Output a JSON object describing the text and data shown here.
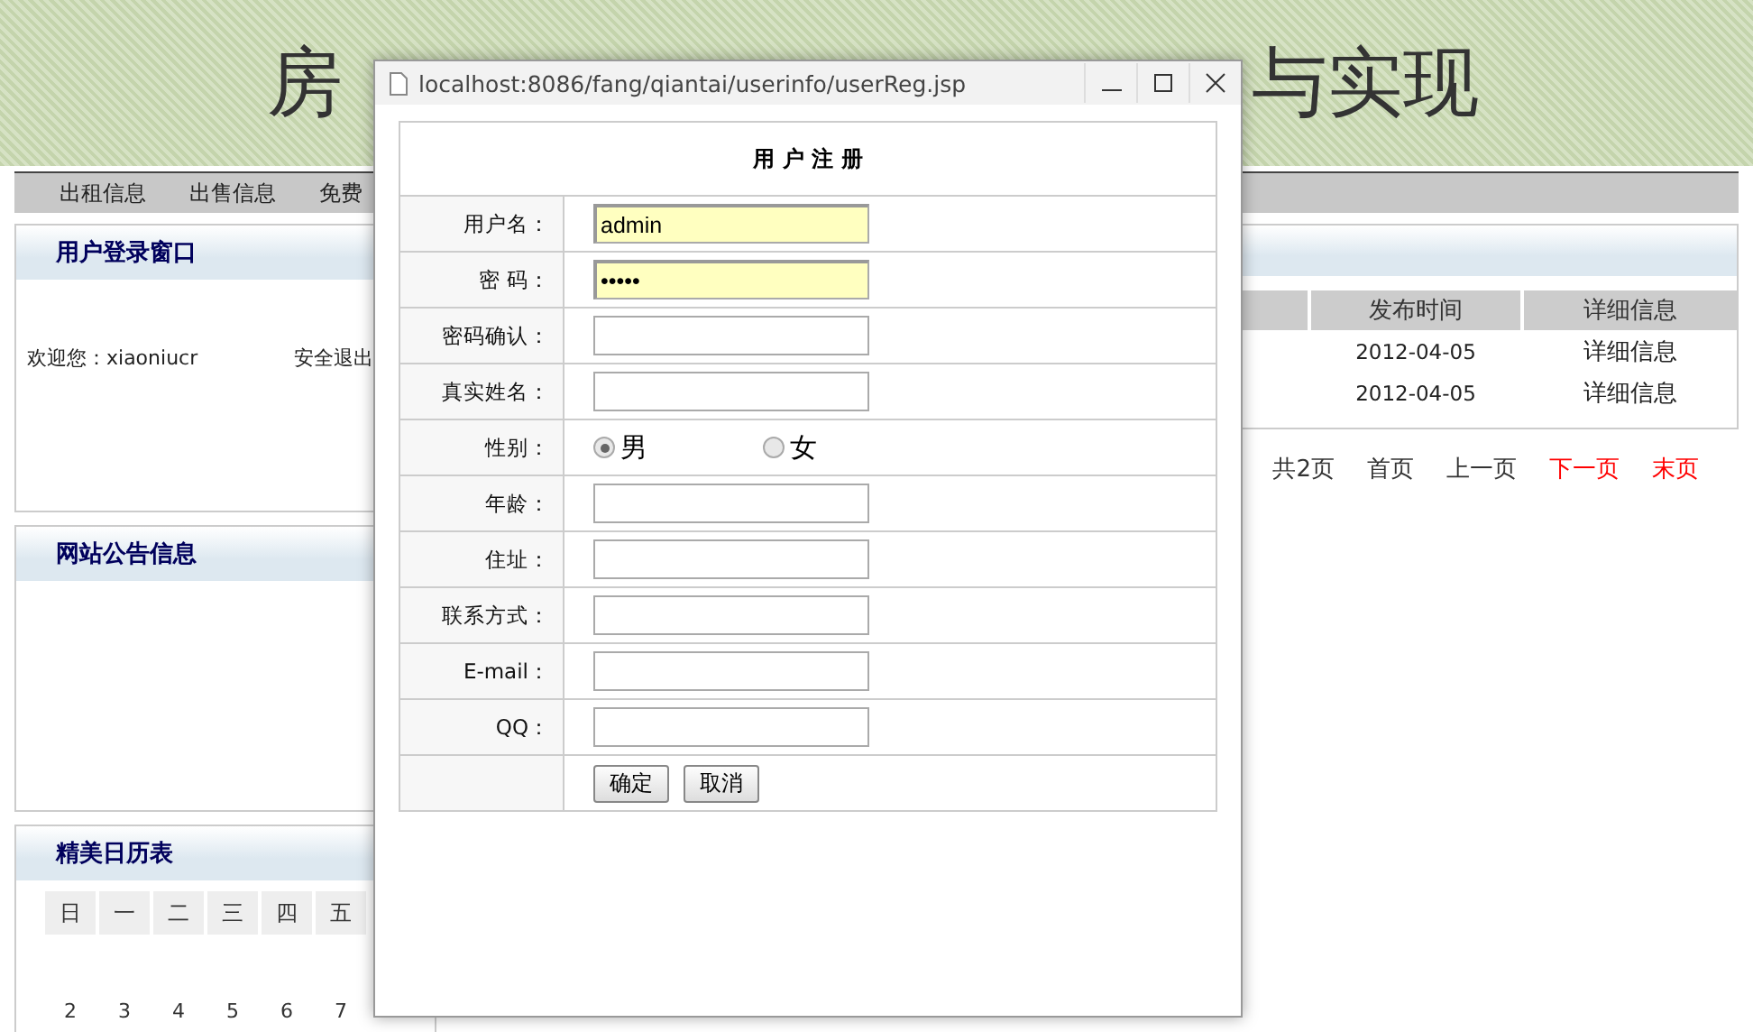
{
  "banner": {
    "title_left": "房",
    "title_right": "与实现"
  },
  "menu": [
    "出租信息",
    "出售信息",
    "免费"
  ],
  "login_panel": {
    "title": "用户登录窗口",
    "welcome": "欢迎您：xiaoniucr",
    "logout": "安全退出"
  },
  "notice_panel": {
    "title": "网站公告信息"
  },
  "calendar": {
    "title": "精美日历表",
    "weekdays": [
      "日",
      "一",
      "二",
      "三",
      "四",
      "五"
    ],
    "days": [
      "2",
      "3",
      "4",
      "5",
      "6",
      "7"
    ]
  },
  "listing": {
    "columns": [
      "发布时间",
      "详细信息"
    ],
    "rows": [
      {
        "date": "2012-04-05",
        "detail": "详细信息"
      },
      {
        "date": "2012-04-05",
        "detail": "详细信息"
      }
    ]
  },
  "pagination": [
    {
      "label": "共2页",
      "active": false
    },
    {
      "label": "首页",
      "active": false
    },
    {
      "label": "上一页",
      "active": false
    },
    {
      "label": "下一页",
      "active": true
    },
    {
      "label": "末页",
      "active": true
    }
  ],
  "popup": {
    "url": "localhost:8086/fang/qiantai/userinfo/userReg.jsp",
    "form_title": "用 户 注 册",
    "fields": [
      {
        "label": "用户名：",
        "kind": "text",
        "value": "admin",
        "highlighted": true
      },
      {
        "label": "密 码：",
        "kind": "text",
        "value": "•••••",
        "highlighted": true
      },
      {
        "label": "密码确认：",
        "kind": "text",
        "highlighted": false
      },
      {
        "label": "真实姓名：",
        "kind": "text",
        "highlighted": false
      },
      {
        "label": "性别：",
        "kind": "radio",
        "options": [
          {
            "label": "男",
            "selected": true
          },
          {
            "label": "女",
            "selected": false
          }
        ]
      },
      {
        "label": "年龄：",
        "kind": "text",
        "highlighted": false
      },
      {
        "label": "住址：",
        "kind": "text",
        "highlighted": false
      },
      {
        "label": "联系方式：",
        "kind": "text",
        "highlighted": false
      },
      {
        "label": "E-mail：",
        "kind": "text",
        "highlighted": false
      },
      {
        "label": "QQ：",
        "kind": "text",
        "highlighted": false
      }
    ],
    "buttons": [
      "确定",
      "取消"
    ]
  }
}
